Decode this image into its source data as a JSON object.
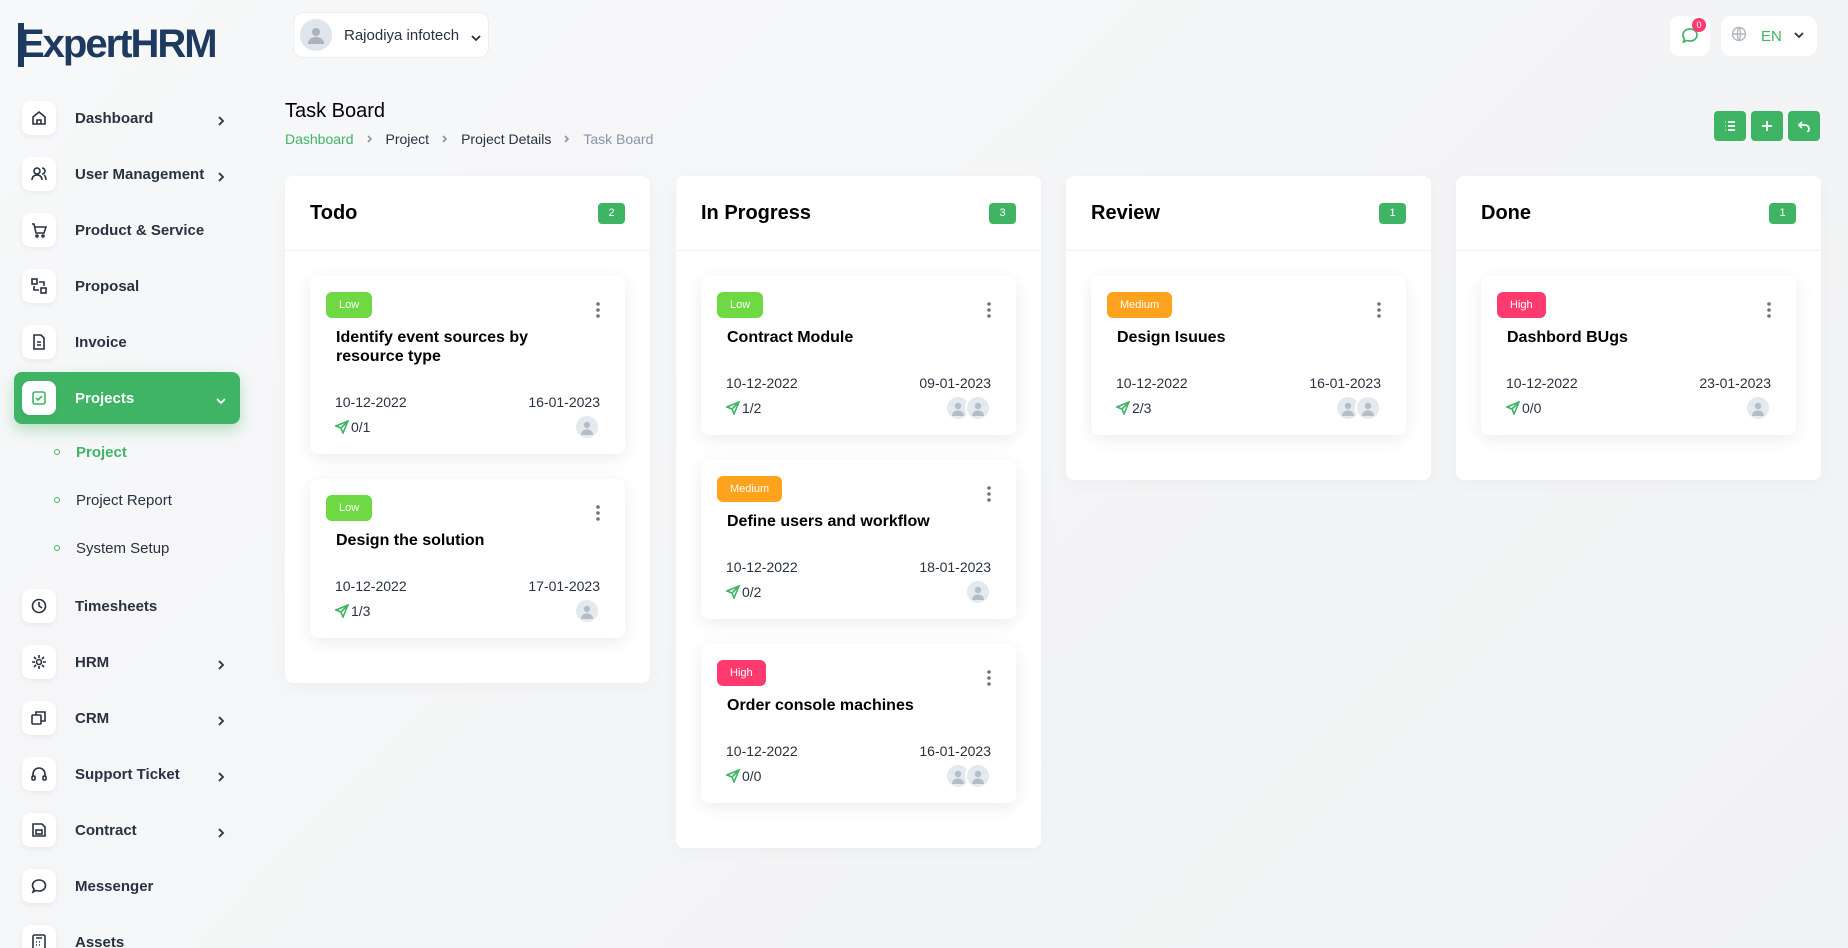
{
  "app": {
    "logo_text": "ExpertHRM"
  },
  "sidebar": {
    "items": [
      {
        "label": "Dashboard",
        "icon": "home-icon",
        "arrow": true
      },
      {
        "label": "User Management",
        "icon": "users-icon",
        "arrow": true
      },
      {
        "label": "Product & Service",
        "icon": "cart-icon",
        "arrow": false
      },
      {
        "label": "Proposal",
        "icon": "proposal-icon",
        "arrow": false
      },
      {
        "label": "Invoice",
        "icon": "invoice-icon",
        "arrow": false
      },
      {
        "label": "Projects",
        "icon": "checkbox-icon",
        "arrow": true,
        "active": true
      },
      {
        "label": "Timesheets",
        "icon": "clock-icon",
        "arrow": false
      },
      {
        "label": "HRM",
        "icon": "hrm-icon",
        "arrow": true
      },
      {
        "label": "CRM",
        "icon": "crm-icon",
        "arrow": true
      },
      {
        "label": "Support Ticket",
        "icon": "headphones-icon",
        "arrow": true
      },
      {
        "label": "Contract",
        "icon": "contract-icon",
        "arrow": true
      },
      {
        "label": "Messenger",
        "icon": "chat-icon",
        "arrow": false
      },
      {
        "label": "Assets",
        "icon": "calculator-icon",
        "arrow": false
      }
    ],
    "projects_sub": [
      {
        "label": "Project",
        "current": true
      },
      {
        "label": "Project Report",
        "current": false
      },
      {
        "label": "System Setup",
        "current": false
      }
    ]
  },
  "header": {
    "company": "Rajodiya infotech",
    "messages_count": "0",
    "language": "EN"
  },
  "page": {
    "title": "Task Board",
    "breadcrumb": [
      "Dashboard",
      "Project",
      "Project Details",
      "Task Board"
    ]
  },
  "colors": {
    "accent": "#3fb465",
    "low": "#6fd943",
    "medium": "#ffa21d",
    "high": "#ff3a6e"
  },
  "board": {
    "columns": [
      {
        "title": "Todo",
        "count": "2",
        "tasks": [
          {
            "priority": "Low",
            "title": "Identify event sources by resource type",
            "start": "10-12-2022",
            "end": "16-01-2023",
            "progress": "0/1",
            "users": 1
          },
          {
            "priority": "Low",
            "title": "Design the solution",
            "start": "10-12-2022",
            "end": "17-01-2023",
            "progress": "1/3",
            "users": 1
          }
        ]
      },
      {
        "title": "In Progress",
        "count": "3",
        "tasks": [
          {
            "priority": "Low",
            "title": "Contract Module",
            "start": "10-12-2022",
            "end": "09-01-2023",
            "progress": "1/2",
            "users": 2
          },
          {
            "priority": "Medium",
            "title": "Define users and workflow",
            "start": "10-12-2022",
            "end": "18-01-2023",
            "progress": "0/2",
            "users": 1
          },
          {
            "priority": "High",
            "title": "Order console machines",
            "start": "10-12-2022",
            "end": "16-01-2023",
            "progress": "0/0",
            "users": 2
          }
        ]
      },
      {
        "title": "Review",
        "count": "1",
        "tasks": [
          {
            "priority": "Medium",
            "title": "Design Isuues",
            "start": "10-12-2022",
            "end": "16-01-2023",
            "progress": "2/3",
            "users": 2
          }
        ]
      },
      {
        "title": "Done",
        "count": "1",
        "tasks": [
          {
            "priority": "High",
            "title": "Dashbord BUgs",
            "start": "10-12-2022",
            "end": "23-01-2023",
            "progress": "0/0",
            "users": 1
          }
        ]
      }
    ]
  }
}
